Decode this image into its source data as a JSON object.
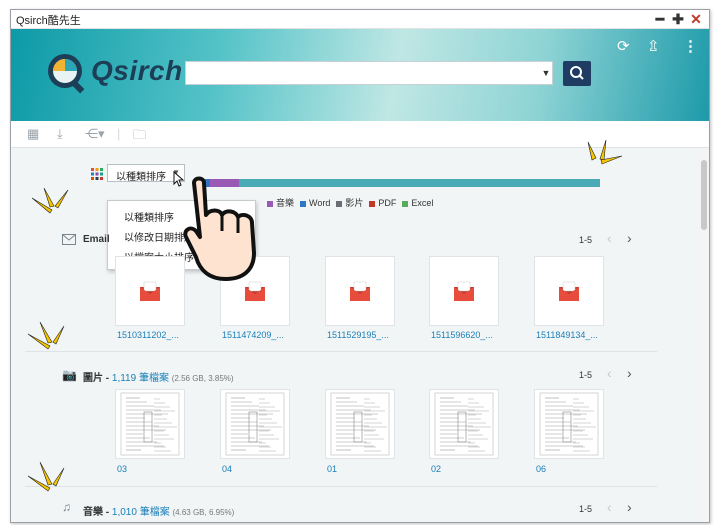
{
  "window": {
    "title": "Qsirch酷先生",
    "min": "━",
    "max": "✚",
    "close": "✕"
  },
  "header": {
    "logo_text": "Qsirch",
    "search_value": "",
    "search_placeholder": ""
  },
  "sort": {
    "selected": "以種類排序",
    "options": [
      "以種類排序",
      "以修改日期排序",
      "以檔案大小排序"
    ]
  },
  "legend": [
    {
      "label": "音樂",
      "color": "#9b59b6"
    },
    {
      "label": "Word",
      "color": "#2e77c7"
    },
    {
      "label": "影片",
      "color": "#6b6f75"
    },
    {
      "label": "PDF",
      "color": "#c0392b"
    },
    {
      "label": "Excel",
      "color": "#5aab5a"
    }
  ],
  "type_bar": {
    "colors": [
      "#2e77c7",
      "#9b59b6",
      "#49aab5"
    ],
    "fractions": [
      0.04,
      0.07,
      0.89
    ]
  },
  "sections": [
    {
      "name": "Email",
      "icon": "envelope-icon",
      "pager": "1-5",
      "files": [
        "1510311202_...",
        "1511474209_...",
        "1511529195_...",
        "1511596620_...",
        "1511849134_..."
      ]
    },
    {
      "name": "圖片",
      "icon": "camera-icon",
      "count": "1,119 筆檔案",
      "meta": "(2.56 GB, 3.85%)",
      "pager": "1-5",
      "files": [
        "03",
        "04",
        "01",
        "02",
        "06"
      ]
    },
    {
      "name": "音樂",
      "icon": "music-icon",
      "count": "1,010 筆檔案",
      "meta": "(4.63 GB, 6.95%)",
      "pager": "1-5"
    }
  ],
  "dash": " - ",
  "colors": {
    "accent": "#1a7fb8",
    "search_button": "#1f3d63",
    "spark": "#f5c400"
  }
}
